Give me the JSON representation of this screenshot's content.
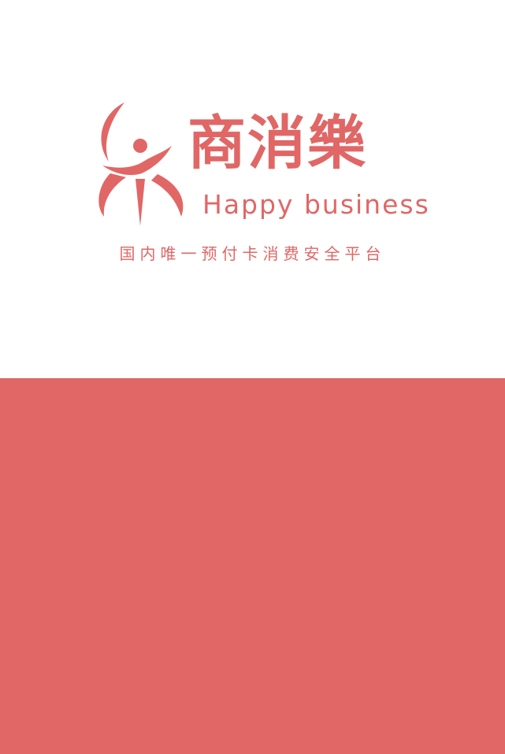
{
  "colors": {
    "brand": "#e06766",
    "background": "#ffffff"
  },
  "logo": {
    "icon": "dancing-figure-logo-icon",
    "name_cn": "商消樂",
    "name_en": "Happy  business"
  },
  "tagline": "国内唯一预付卡消费安全平台"
}
